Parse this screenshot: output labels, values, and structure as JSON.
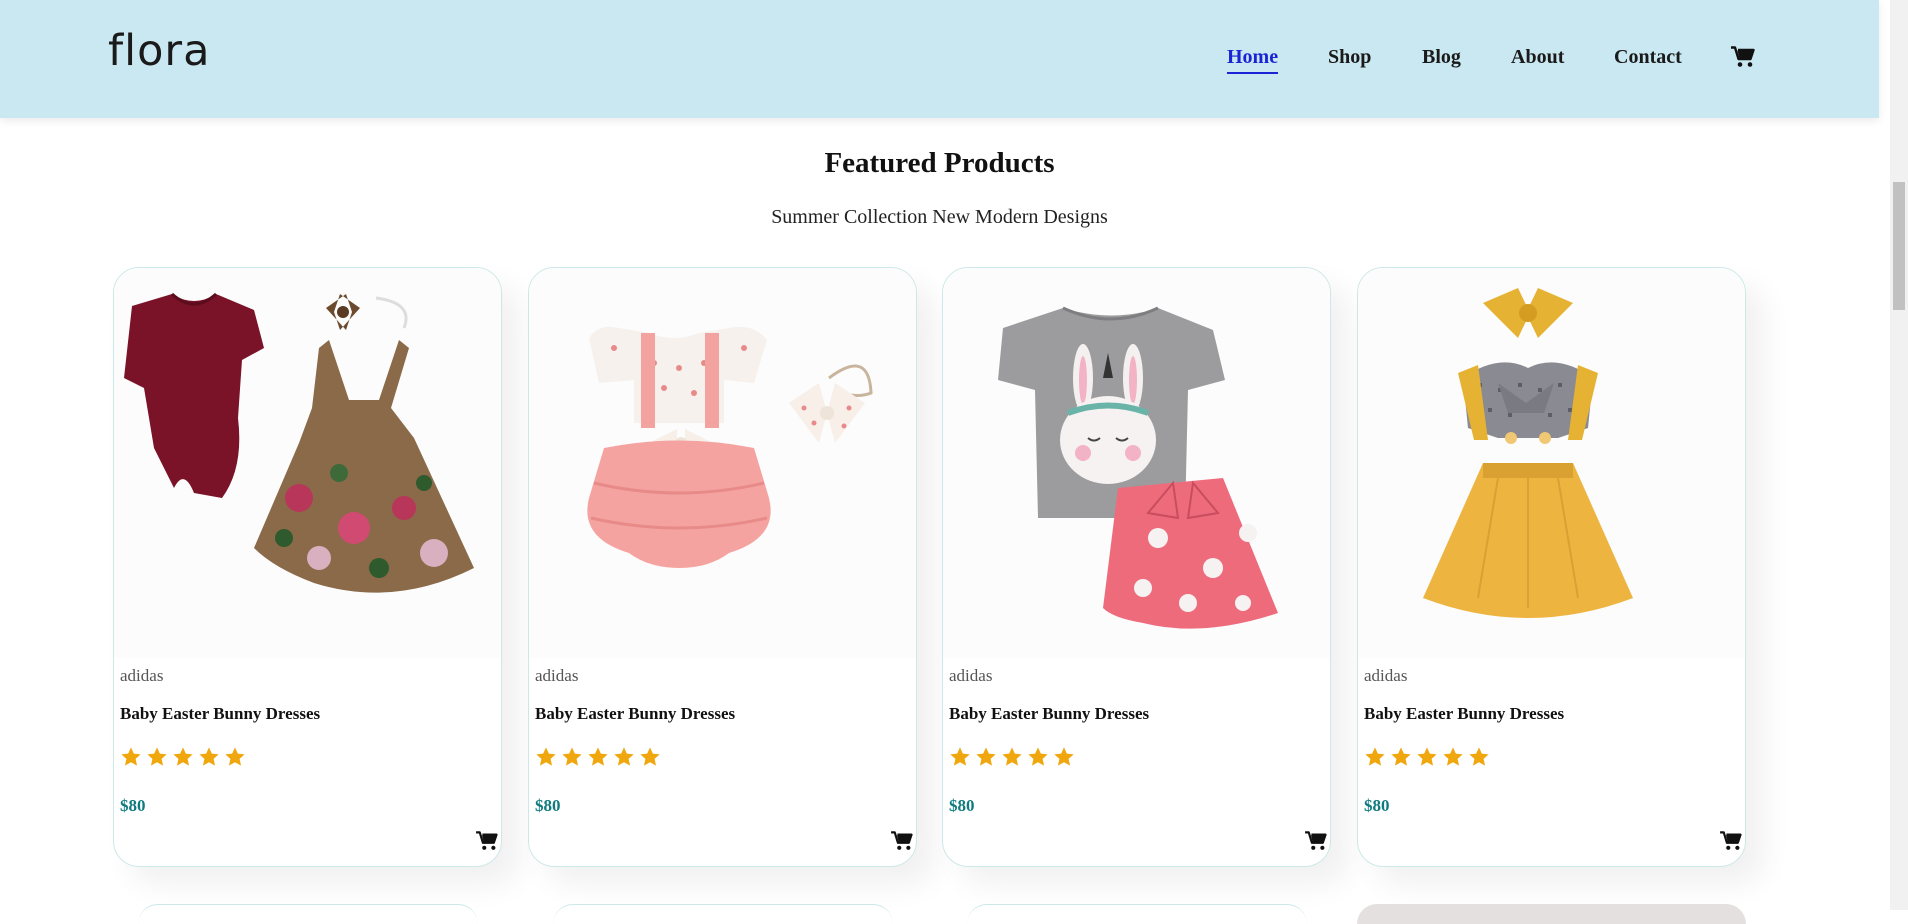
{
  "header": {
    "logo": "flora",
    "nav": [
      {
        "label": "Home",
        "active": true
      },
      {
        "label": "Shop",
        "active": false
      },
      {
        "label": "Blog",
        "active": false
      },
      {
        "label": "About",
        "active": false
      },
      {
        "label": "Contact",
        "active": false
      }
    ],
    "cart_icon": "cart-icon"
  },
  "section": {
    "title": "Featured Products",
    "subtitle": "Summer Collection New Modern Designs"
  },
  "products": [
    {
      "brand": "adidas",
      "name": "Baby Easter Bunny Dresses",
      "rating": 5,
      "price": "$80",
      "image": "burgundy-bodysuit-floral-pinafore-with-bow-headband"
    },
    {
      "brand": "adidas",
      "name": "Baby Easter Bunny Dresses",
      "rating": 5,
      "price": "$80",
      "image": "pink-ruffle-heart-romper-with-bow-headband"
    },
    {
      "brand": "adidas",
      "name": "Baby Easter Bunny Dresses",
      "rating": 5,
      "price": "$80",
      "image": "grey-bunny-tee-with-pink-bunny-skirt"
    },
    {
      "brand": "adidas",
      "name": "Baby Easter Bunny Dresses",
      "rating": 5,
      "price": "$80",
      "image": "mustard-suspender-dress-with-headband"
    }
  ],
  "colors": {
    "header_bg": "#c9e8f1",
    "active_nav": "#1a24d6",
    "price": "#0f7b7f",
    "star": "#f0a70d"
  }
}
